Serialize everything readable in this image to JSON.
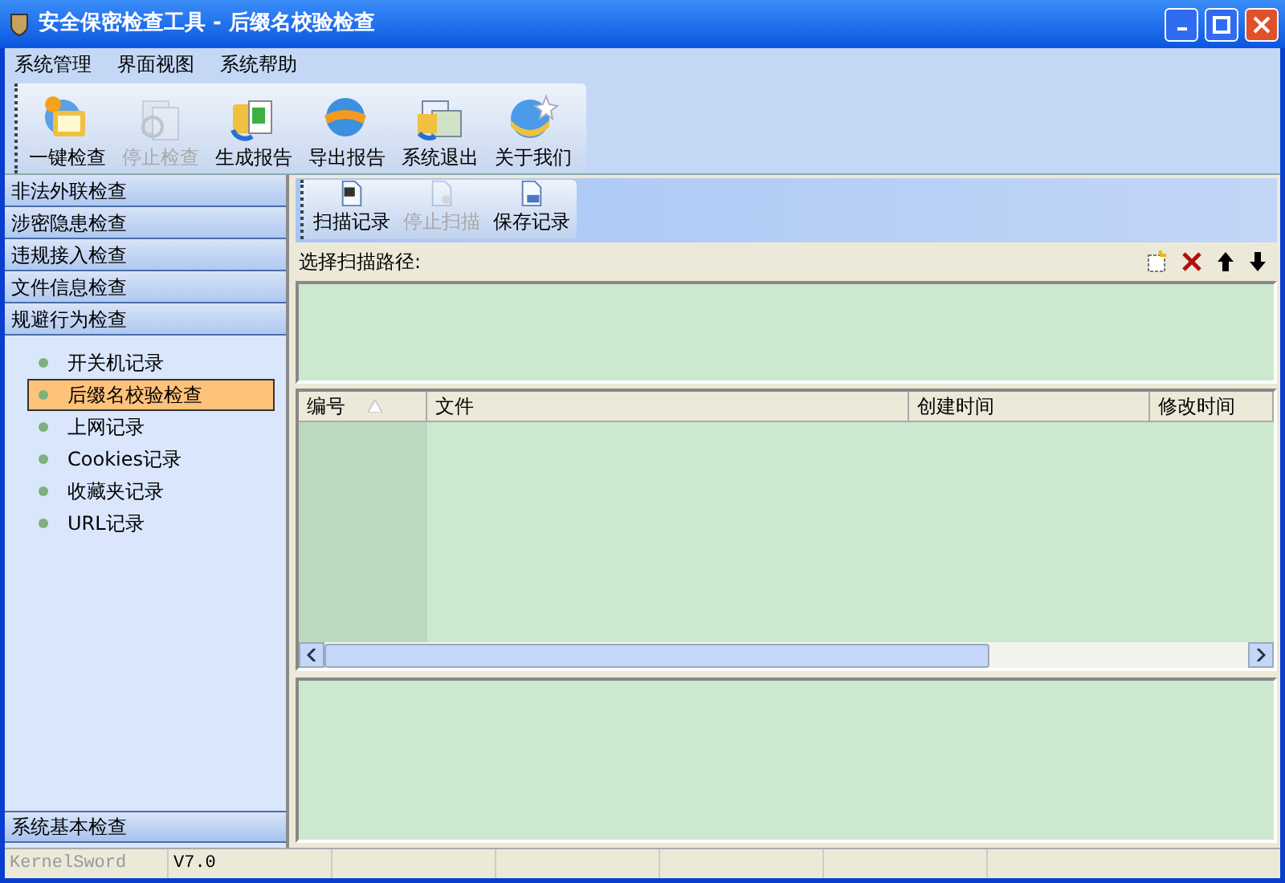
{
  "window": {
    "title": "安全保密检查工具 - 后缀名校验检查"
  },
  "menu": [
    "系统管理",
    "界面视图",
    "系统帮助"
  ],
  "toolbar": [
    {
      "label": "一键检查",
      "disabled": false
    },
    {
      "label": "停止检查",
      "disabled": true
    },
    {
      "label": "生成报告",
      "disabled": false
    },
    {
      "label": "导出报告",
      "disabled": false
    },
    {
      "label": "系统退出",
      "disabled": false
    },
    {
      "label": "关于我们",
      "disabled": false
    }
  ],
  "sidebar": {
    "categories": [
      "非法外联检查",
      "涉密隐患检查",
      "违规接入检查",
      "文件信息检查",
      "规避行为检查"
    ],
    "items": [
      {
        "label": "开关机记录",
        "selected": false
      },
      {
        "label": "后缀名校验检查",
        "selected": true
      },
      {
        "label": "上网记录",
        "selected": false
      },
      {
        "label": "Cookies记录",
        "selected": false
      },
      {
        "label": "收藏夹记录",
        "selected": false
      },
      {
        "label": "URL记录",
        "selected": false
      }
    ],
    "bottom_category": "系统基本检查"
  },
  "scan_toolbar": [
    {
      "label": "扫描记录",
      "disabled": false
    },
    {
      "label": "停止扫描",
      "disabled": true
    },
    {
      "label": "保存记录",
      "disabled": false
    }
  ],
  "path_label": "选择扫描路径:",
  "table": {
    "columns": [
      {
        "label": "编号",
        "sorted": true
      },
      {
        "label": "文件",
        "sorted": false
      },
      {
        "label": "创建时间",
        "sorted": false
      },
      {
        "label": "修改时间",
        "sorted": false
      }
    ]
  },
  "status_bar": [
    {
      "text": "KernelSword",
      "disabled": true
    },
    {
      "text": "V7.0",
      "disabled": false
    }
  ]
}
